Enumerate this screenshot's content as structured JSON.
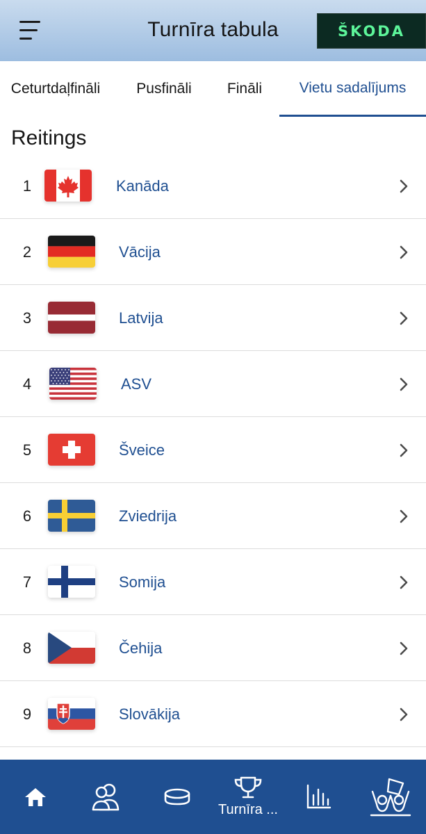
{
  "header": {
    "title": "Turnīra tabula",
    "menu_icon": "hamburger-menu-icon",
    "sponsor_logo_text": "ŠKODA"
  },
  "tabs": [
    {
      "label": "Ceturtdaļfināli",
      "active": false
    },
    {
      "label": "Pusfināli",
      "active": false
    },
    {
      "label": "Fināli",
      "active": false
    },
    {
      "label": "Vietu sadalījums",
      "active": true
    }
  ],
  "section": {
    "title": "Reitings"
  },
  "rankings": [
    {
      "rank": "1",
      "country": "Kanāda",
      "flag": "canada-flag-icon"
    },
    {
      "rank": "2",
      "country": "Vācija",
      "flag": "germany-flag-icon"
    },
    {
      "rank": "3",
      "country": "Latvija",
      "flag": "latvia-flag-icon"
    },
    {
      "rank": "4",
      "country": "ASV",
      "flag": "usa-flag-icon"
    },
    {
      "rank": "5",
      "country": "Šveice",
      "flag": "switzerland-flag-icon"
    },
    {
      "rank": "6",
      "country": "Zviedrija",
      "flag": "sweden-flag-icon"
    },
    {
      "rank": "7",
      "country": "Somija",
      "flag": "finland-flag-icon"
    },
    {
      "rank": "8",
      "country": "Čehija",
      "flag": "czechia-flag-icon"
    },
    {
      "rank": "9",
      "country": "Slovākija",
      "flag": "slovakia-flag-icon"
    }
  ],
  "bottom_nav": [
    {
      "icon": "home-icon",
      "label": ""
    },
    {
      "icon": "players-icon",
      "label": ""
    },
    {
      "icon": "puck-icon",
      "label": ""
    },
    {
      "icon": "trophy-icon",
      "label": "Turnīra ..."
    },
    {
      "icon": "stats-chart-icon",
      "label": ""
    },
    {
      "icon": "fans-icon",
      "label": ""
    }
  ],
  "colors": {
    "accent": "#1f4f91",
    "header_gradient_top": "#c9dbee",
    "header_gradient_bottom": "#9dbde0",
    "sponsor_bg": "#0c2a22",
    "sponsor_text": "#5df59a",
    "divider": "#dcdcdc"
  }
}
